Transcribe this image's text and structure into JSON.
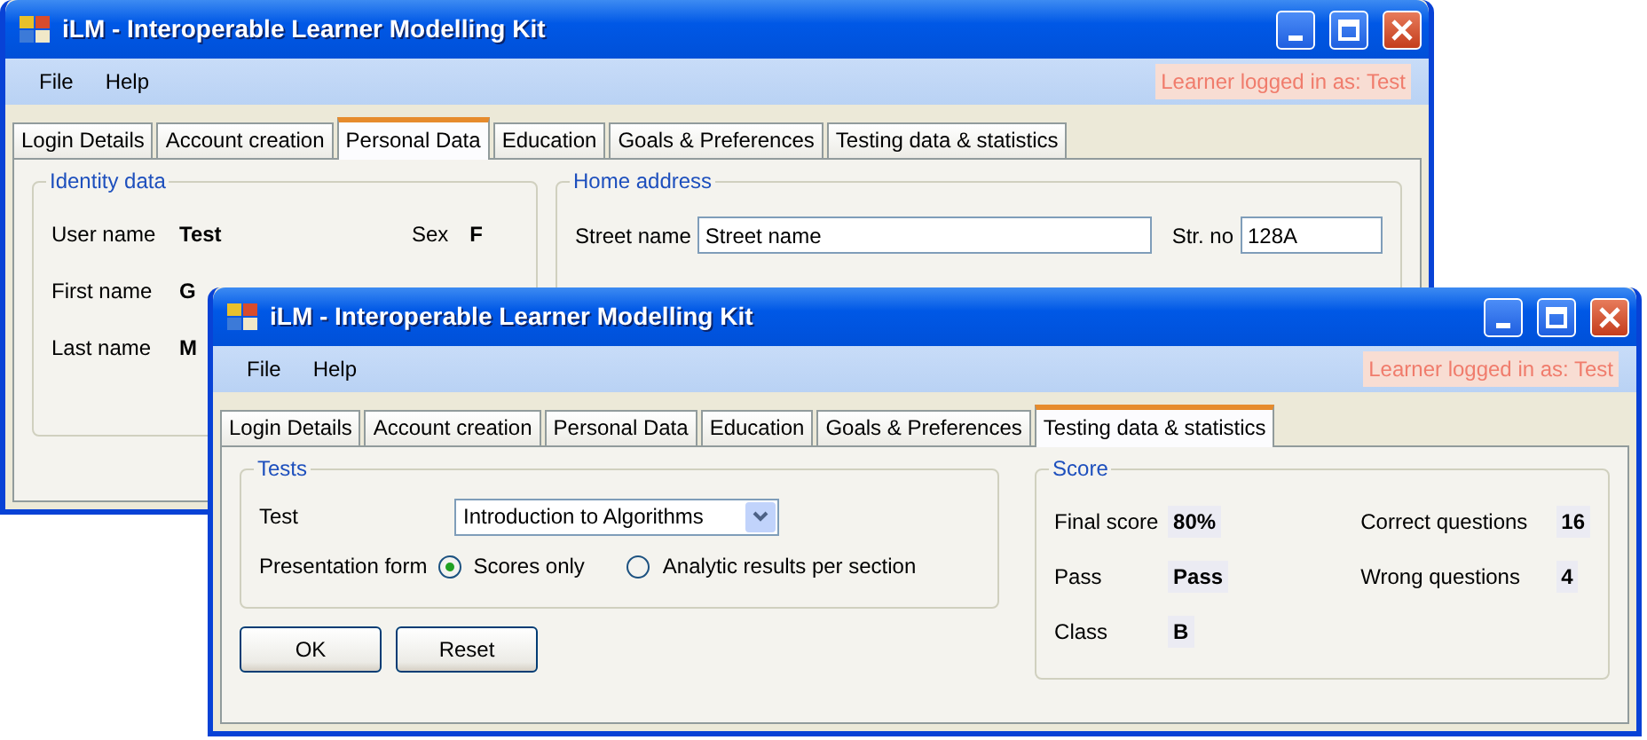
{
  "windows": [
    {
      "title": "iLM - Interoperable Learner Modelling Kit",
      "menu": [
        "File",
        "Help"
      ],
      "status": "Learner logged in as: Test",
      "tabs": [
        {
          "label": "Login Details",
          "selected": false
        },
        {
          "label": "Account creation",
          "selected": false
        },
        {
          "label": "Personal Data",
          "selected": true
        },
        {
          "label": "Education",
          "selected": false
        },
        {
          "label": "Goals & Preferences",
          "selected": false
        },
        {
          "label": "Testing data & statistics",
          "selected": false
        }
      ],
      "identity": {
        "title": "Identity data",
        "fields": [
          {
            "label": "User name",
            "value": "Test"
          },
          {
            "label": "First name",
            "value": "G"
          },
          {
            "label": "Last name",
            "value": "M"
          }
        ],
        "sex": {
          "label": "Sex",
          "value": "F"
        }
      },
      "home_address": {
        "title": "Home address",
        "street": {
          "label": "Street name",
          "value": "Street name"
        },
        "number": {
          "label": "Str. no",
          "value": "128A"
        }
      }
    },
    {
      "title": "iLM - Interoperable Learner Modelling Kit",
      "menu": [
        "File",
        "Help"
      ],
      "status": "Learner logged in as: Test",
      "tabs": [
        {
          "label": "Login Details",
          "selected": false
        },
        {
          "label": "Account creation",
          "selected": false
        },
        {
          "label": "Personal Data",
          "selected": false
        },
        {
          "label": "Education",
          "selected": false
        },
        {
          "label": "Goals & Preferences",
          "selected": false
        },
        {
          "label": "Testing data & statistics",
          "selected": true
        }
      ],
      "tests": {
        "title": "Tests",
        "test": {
          "label": "Test",
          "value": "Introduction to Algorithms"
        },
        "presentation": {
          "label": "Presentation form",
          "options": [
            {
              "label": "Scores only",
              "selected": true
            },
            {
              "label": "Analytic results per section",
              "selected": false
            }
          ]
        }
      },
      "buttons": [
        "OK",
        "Reset"
      ],
      "score": {
        "title": "Score",
        "columns": [
          [
            {
              "label": "Final score",
              "value": "80%"
            },
            {
              "label": "Pass",
              "value": "Pass"
            },
            {
              "label": "Class",
              "value": "B"
            }
          ],
          [
            {
              "label": "Correct questions",
              "value": "16"
            },
            {
              "label": "Wrong questions",
              "value": "4"
            }
          ]
        ]
      }
    }
  ]
}
